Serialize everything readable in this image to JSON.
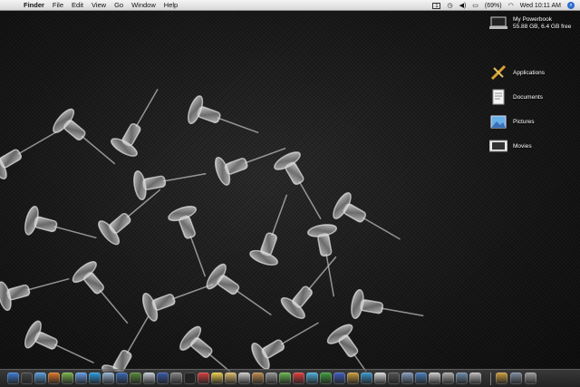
{
  "menubar": {
    "apple_symbol": "",
    "app_name": "Finder",
    "items": [
      "File",
      "Edit",
      "View",
      "Go",
      "Window",
      "Help"
    ],
    "status": {
      "input_menu": "1",
      "battery": "(69%)",
      "clock": "Wed 10:11 AM"
    }
  },
  "desktop": {
    "hard_drive": {
      "name": "My Powerbook",
      "info": "55.88 GB, 6.4 GB free",
      "icon": "laptop-icon"
    },
    "folders": [
      {
        "label": "Applications",
        "icon": "applications-folder-icon"
      },
      {
        "label": "Documents",
        "icon": "documents-folder-icon"
      },
      {
        "label": "Pictures",
        "icon": "pictures-folder-icon"
      },
      {
        "label": "Movies",
        "icon": "movies-folder-icon"
      }
    ]
  },
  "dock": {
    "icons": [
      {
        "name": "finder-icon",
        "color": "#3f7fd6"
      },
      {
        "name": "dashboard-icon",
        "color": "#444444"
      },
      {
        "name": "safari-icon",
        "color": "#5aa0e0"
      },
      {
        "name": "firefox-icon",
        "color": "#e07a2a"
      },
      {
        "name": "adium-icon",
        "color": "#7bb74b"
      },
      {
        "name": "itunes-icon",
        "color": "#6aa0e8"
      },
      {
        "name": "skype-icon",
        "color": "#2b9de0"
      },
      {
        "name": "mail-icon",
        "color": "#9ab8d8"
      },
      {
        "name": "web-icon",
        "color": "#3a6ab8"
      },
      {
        "name": "tool-icon",
        "color": "#5a8a3a"
      },
      {
        "name": "iphoto-icon",
        "color": "#c8d0d8"
      },
      {
        "name": "quicktime-icon",
        "color": "#3a5aa8"
      },
      {
        "name": "pro-app-icon",
        "color": "#888888"
      },
      {
        "name": "terminal-icon",
        "color": "#222222"
      },
      {
        "name": "calendar-icon",
        "color": "#d84040"
      },
      {
        "name": "notes-icon",
        "color": "#f0d050"
      },
      {
        "name": "photoshop-icon",
        "color": "#e0c070"
      },
      {
        "name": "textedit-icon",
        "color": "#d0d0d0"
      },
      {
        "name": "garageband-icon",
        "color": "#c09050"
      },
      {
        "name": "system-icon",
        "color": "#9a9a9a"
      },
      {
        "name": "pen-icon",
        "color": "#6ab850"
      },
      {
        "name": "music-icon",
        "color": "#e04040"
      },
      {
        "name": "chat-icon",
        "color": "#50b0e0"
      },
      {
        "name": "green-app-icon",
        "color": "#40a040"
      },
      {
        "name": "blue-app-icon",
        "color": "#4060c0"
      },
      {
        "name": "tiles-icon",
        "color": "#d0a040"
      },
      {
        "name": "book-icon",
        "color": "#3a9ad0"
      },
      {
        "name": "white-app-icon",
        "color": "#e0e0e0"
      },
      {
        "name": "spider-icon",
        "color": "#555555"
      },
      {
        "name": "network-icon",
        "color": "#8aa0c0"
      },
      {
        "name": "globe-icon",
        "color": "#4a80c0"
      },
      {
        "name": "upload-icon",
        "color": "#d0d0d0"
      },
      {
        "name": "disk-icon",
        "color": "#b0b0b0"
      },
      {
        "name": "utility-icon",
        "color": "#7090b0"
      },
      {
        "name": "preview-icon",
        "color": "#c0c0c0"
      }
    ],
    "right_icons": [
      {
        "name": "applications-stack-icon",
        "color": "#d0a040"
      },
      {
        "name": "documents-stack-icon",
        "color": "#8090a0"
      },
      {
        "name": "trash-icon",
        "color": "#a0a0a0"
      }
    ]
  }
}
